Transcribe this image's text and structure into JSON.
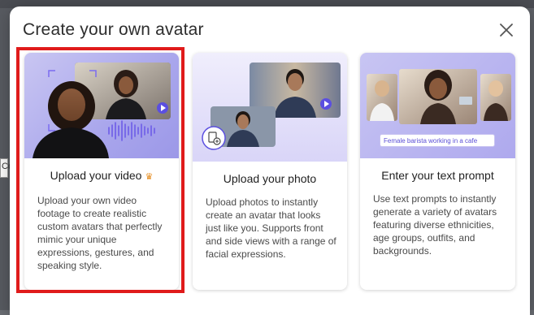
{
  "backdrop": {
    "partial_field_text": "Co"
  },
  "modal": {
    "title": "Create your own avatar",
    "close_icon": "close-icon"
  },
  "cards": [
    {
      "title": "Upload your video",
      "badge_icon": "crown-icon",
      "description": "Upload your own video footage to create realistic custom avatars that perfectly mimic your unique expressions, gestures, and speaking style.",
      "selected": true
    },
    {
      "title": "Upload your photo",
      "description": "Upload photos to instantly create an avatar that looks just like you. Supports front and side views with a range of facial expressions.",
      "selected": false
    },
    {
      "title": "Enter your text prompt",
      "description": "Use text prompts to instantly generate a variety of avatars featuring diverse ethnicities, age groups, outfits, and backgrounds.",
      "prompt_example": "Female barista working in a cafe",
      "selected": false
    }
  ],
  "colors": {
    "selection_border": "#e01b1b",
    "accent_purple": "#6d5ce8",
    "crown": "#e58a1a"
  }
}
